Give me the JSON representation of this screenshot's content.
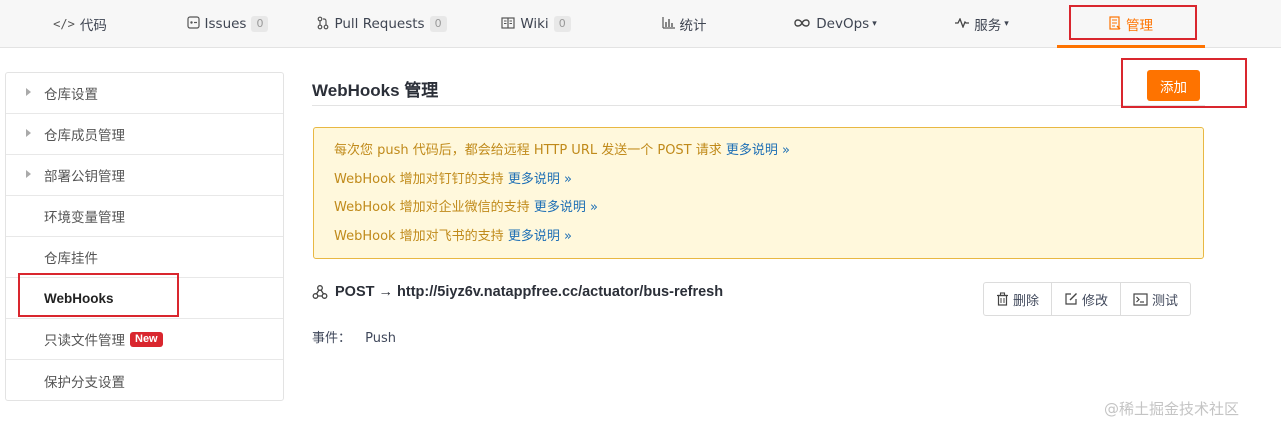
{
  "tabs": [
    {
      "id": "code",
      "icon": "code-icon",
      "icon_glyph": "</>",
      "label": "代码"
    },
    {
      "id": "issues",
      "icon": "issues-icon",
      "label": "Issues",
      "count": "0"
    },
    {
      "id": "pulls",
      "icon": "pull-request-icon",
      "label": "Pull Requests",
      "count": "0"
    },
    {
      "id": "wiki",
      "icon": "wiki-icon",
      "label": "Wiki",
      "count": "0"
    },
    {
      "id": "stats",
      "icon": "chart-icon",
      "label": "统计"
    },
    {
      "id": "devops",
      "icon": "infinity-icon",
      "label": "DevOps"
    },
    {
      "id": "services",
      "icon": "pulse-icon",
      "label": "服务"
    },
    {
      "id": "manage",
      "icon": "manage-icon",
      "label": "管理",
      "active": true
    }
  ],
  "sidebar": {
    "items": [
      {
        "label": "仓库设置",
        "expandable": true
      },
      {
        "label": "仓库成员管理",
        "expandable": true
      },
      {
        "label": "部署公钥管理",
        "expandable": true
      },
      {
        "label": "环境变量管理"
      },
      {
        "label": "仓库挂件"
      },
      {
        "label": "WebHooks",
        "active": true
      },
      {
        "label": "只读文件管理",
        "badge": "New"
      },
      {
        "label": "保护分支设置"
      }
    ]
  },
  "main": {
    "title": "WebHooks 管理",
    "add_button": "添加",
    "notice": {
      "lines": [
        {
          "text": "每次您 push 代码后，都会给远程 HTTP URL 发送一个 POST 请求 ",
          "link": "更多说明 »"
        },
        {
          "text": "WebHook 增加对钉钉的支持 ",
          "link": "更多说明 »"
        },
        {
          "text": "WebHook 增加对企业微信的支持 ",
          "link": "更多说明 »"
        },
        {
          "text": "WebHook 增加对飞书的支持 ",
          "link": "更多说明 »"
        }
      ]
    },
    "hook": {
      "url_text": "POST → http://5iyz6v.natappfree.cc/actuator/bus-refresh",
      "delete_label": "删除",
      "edit_label": "修改",
      "test_label": "测试",
      "event_label": "事件：",
      "event_value": "Push"
    }
  },
  "watermark": "@稀土掘金技术社区",
  "colors": {
    "accent": "#fe7300",
    "highlight_box": "#d9262e",
    "notice_bg": "#fff8dc",
    "notice_text": "#c08a1a",
    "link": "#1e6fb5"
  }
}
